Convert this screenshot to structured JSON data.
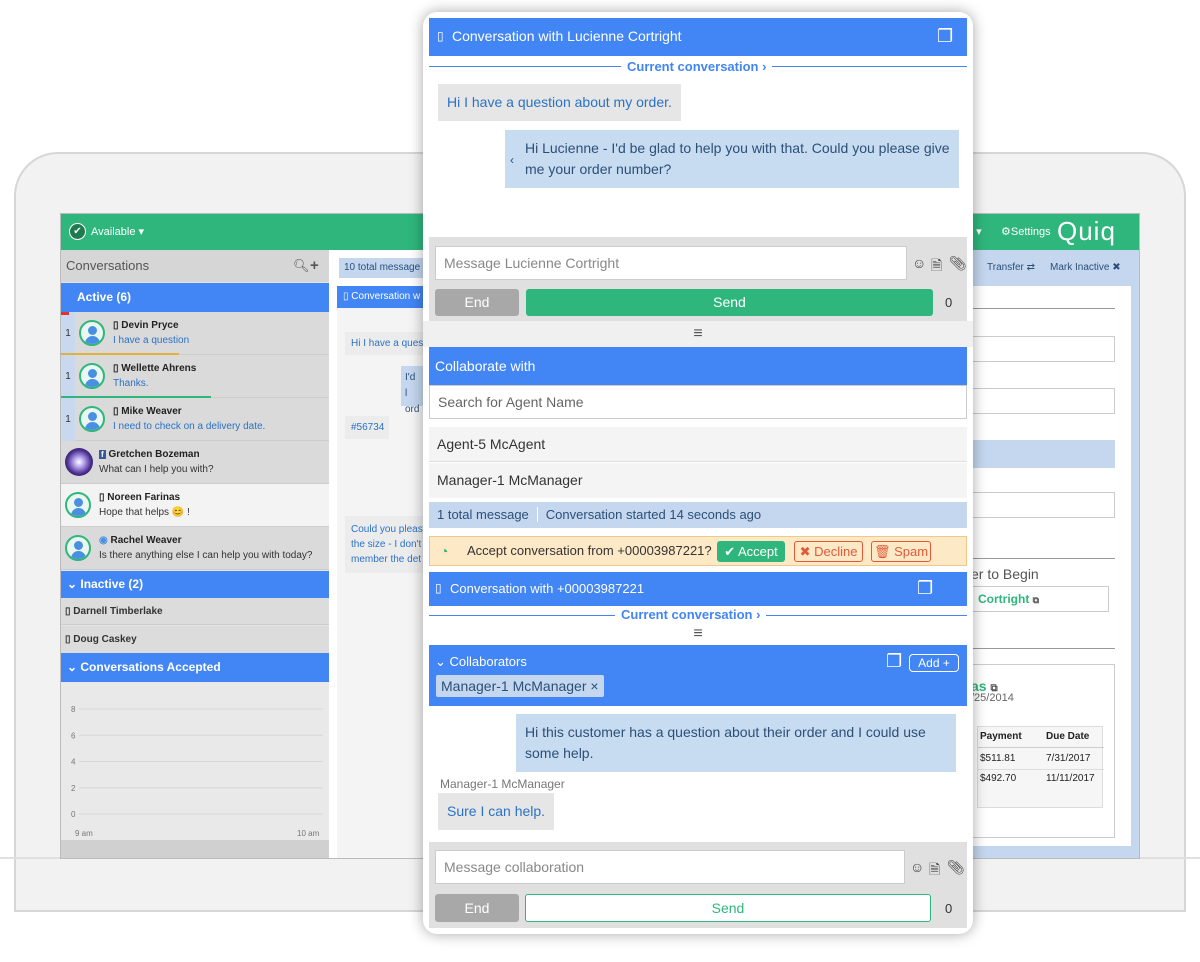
{
  "topbar": {
    "status": "Available",
    "trail": "n",
    "settings": "Settings",
    "brand": "Quiq"
  },
  "left": {
    "title": "Conversations",
    "active_label": "Active (6)",
    "active": [
      {
        "num": "1",
        "name": "Devin Pryce",
        "msg": "I have a question",
        "progress_color": "#e0b23c"
      },
      {
        "num": "1",
        "name": "Wellette Ahrens",
        "msg": "Thanks.",
        "progress_color": "#2fb67c"
      },
      {
        "num": "1",
        "name": "Mike Weaver",
        "msg": "I need to check on a delivery date."
      },
      {
        "name": "Gretchen Bozeman",
        "msg": "What can I help you with?"
      },
      {
        "name": "Noreen Farinas",
        "msg": "Hope that helps 😊 !"
      },
      {
        "name": "Rachel Weaver",
        "msg": "Is there anything else I can help you with today?"
      }
    ],
    "inactive_label": "Inactive (2)",
    "inactive": [
      "Darnell Timberlake",
      "Doug Caskey"
    ],
    "accepted_label": "Conversations Accepted"
  },
  "chart_data": {
    "type": "line",
    "title": "",
    "xlabel": "",
    "ylabel": "",
    "x": [
      "9 am",
      "10 am"
    ],
    "ylim": [
      0,
      8
    ],
    "yticks": [
      "8",
      "6",
      "4",
      "2",
      "0"
    ],
    "series": []
  },
  "middle": {
    "total": "10 total message",
    "conv_tab": "Conversation w",
    "bubble1": "Hi I have a ques",
    "bubble2a": "I'd l",
    "bubble2b": "ord",
    "order_no": "#56734",
    "bubble3a": "Could you pleas",
    "bubble3b": "the size - I don't",
    "bubble3c": "member the det"
  },
  "right": {
    "transfer": "Transfer",
    "mark_inactive": "Mark Inactive",
    "begin": "er to Begin",
    "link": "Cortright",
    "name_partial": "as",
    "date_partial": "/25/2014",
    "table": {
      "headers": [
        "Payment",
        "Due Date"
      ],
      "rows": [
        [
          "$511.81",
          "7/31/2017"
        ],
        [
          "$492.70",
          "11/11/2017"
        ]
      ]
    }
  },
  "phone": {
    "conv1_title": "Conversation with Lucienne Cortright",
    "current_conv": "Current conversation",
    "msg_in": "Hi I have a question about my order.",
    "msg_out": "Hi Lucienne - I'd be glad to help you with that. Could you please give me your order number?",
    "msg_placeholder": "Message Lucienne Cortright",
    "end": "End",
    "send": "Send",
    "count": "0",
    "collab_title": "Collaborate with",
    "collab_search": "Search for Agent Name",
    "agents": [
      "Agent-5 McAgent",
      "Manager-1 McManager"
    ],
    "total_msg": "1 total message",
    "started": "Conversation started 14 seconds ago",
    "accept_text": "Accept conversation from +00003987221?",
    "accept": "Accept",
    "decline": "Decline",
    "spam": "Spam",
    "conv2_title": "Conversation with +00003987221",
    "current_conv2": "Current conversation",
    "collaborators": "Collaborators",
    "add": "Add +",
    "collaborator_chip": "Manager-1 McManager ×",
    "collab_out": "Hi this customer has a question about their order and I could use some help.",
    "collab_sender": "Manager-1 McManager",
    "collab_in": "Sure I can help.",
    "collab_placeholder": "Message collaboration",
    "end2": "End",
    "send2": "Send",
    "count2": "0"
  }
}
